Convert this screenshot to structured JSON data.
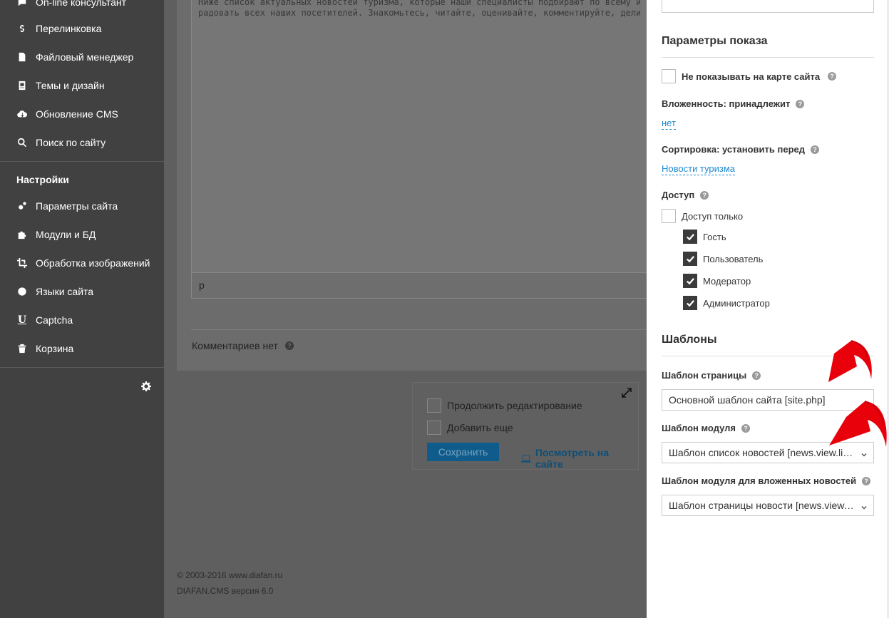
{
  "sidebar": {
    "items": [
      {
        "label": "On-line консультант",
        "icon": "chat-icon"
      },
      {
        "label": "Перелинковка",
        "icon": "link-icon"
      },
      {
        "label": "Файловый менеджер",
        "icon": "file-manager-icon"
      },
      {
        "label": "Темы и дизайн",
        "icon": "theme-icon"
      },
      {
        "label": "Обновление CMS",
        "icon": "cloud-download-icon"
      },
      {
        "label": "Поиск по сайту",
        "icon": "search-icon"
      }
    ],
    "settings_heading": "Настройки",
    "settings_items": [
      {
        "label": "Параметры сайта",
        "icon": "gears-icon"
      },
      {
        "label": "Модули и БД",
        "icon": "puzzle-icon"
      },
      {
        "label": "Обработка изображений",
        "icon": "crop-icon"
      },
      {
        "label": "Языки сайта",
        "icon": "globe-icon"
      },
      {
        "label": "Captcha",
        "icon": "captcha-icon"
      },
      {
        "label": "Корзина",
        "icon": "trash-icon"
      }
    ]
  },
  "editor": {
    "text_line1": "Ниже список актуальных новостей туризма, которые наши специалисты подбирают по всему инфопростр",
    "text_line2": "радовать всех наших посетителей. Знакомьтесь, читайте, оценивайте, комментируйте, делитесь с друзьям",
    "status_path": "p"
  },
  "comments_label": "Комментариев нет",
  "actions": {
    "continue_editing": "Продолжить редактирование",
    "add_more": "Добавить еще",
    "save": "Сохранить",
    "view_on_site": "Посмотреть на сайте"
  },
  "footer": {
    "copyright": "© 2003-2016 www.diafan.ru",
    "version": "DIAFAN.CMS версия 6.0"
  },
  "panel": {
    "display_title": "Параметры показа",
    "hide_sitemap": "Не показывать на карте сайта",
    "nesting_label": "Вложенность: принадлежит",
    "nesting_value": "нет",
    "sort_label": "Сортировка: установить перед",
    "sort_value": "Новости туризма",
    "access_label": "Доступ",
    "access_only": "Доступ только",
    "access_roles": [
      "Гость",
      "Пользователь",
      "Модератор",
      "Администратор"
    ],
    "templates_title": "Шаблоны",
    "page_template_label": "Шаблон страницы",
    "page_template_value": "Основной шаблон сайта [site.php]",
    "module_template_label": "Шаблон модуля",
    "module_template_value": "Шаблон список новостей [news.view.list.php]",
    "nested_template_label": "Шаблон модуля для вложенных новостей",
    "nested_template_value": "Шаблон страницы новости [news.view.id.php]"
  },
  "colors": {
    "arrow": "#e8000b",
    "link": "#1f8ad2",
    "sidebar_bg": "#414141"
  }
}
